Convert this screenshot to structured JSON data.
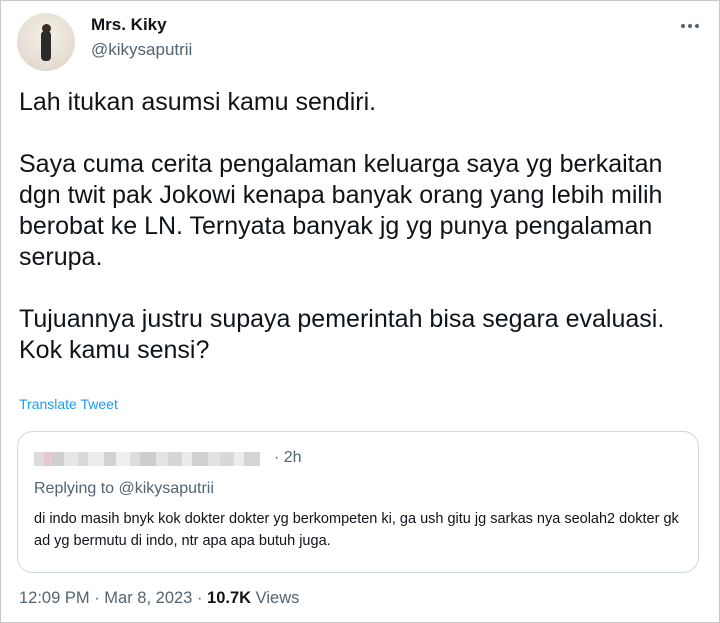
{
  "author": {
    "display_name": "Mrs. Kiky",
    "handle": "@kikysaputrii"
  },
  "tweet": {
    "text": "Lah itukan asumsi kamu sendiri.\n\nSaya cuma cerita pengalaman keluarga saya yg berkaitan dgn twit pak Jokowi kenapa banyak orang yang lebih milih berobat ke LN. Ternyata banyak jg yg punya pengalaman serupa.\n\nTujuannya justru supaya pemerintah bisa segara evaluasi. Kok kamu sensi?",
    "translate_label": "Translate Tweet"
  },
  "quoted_tweet": {
    "time": "· 2h",
    "replying_prefix": "Replying to ",
    "replying_handle": "@kikysaputrii",
    "text": "di indo masih bnyk kok dokter dokter yg berkompeten ki, ga ush gitu jg sarkas nya seolah2 dokter gk ad yg bermutu di indo, ntr apa apa butuh juga."
  },
  "meta": {
    "time": "12:09 PM",
    "separator1": " · ",
    "date": "Mar 8, 2023",
    "separator2": " · ",
    "views_count": "10.7K",
    "views_label": " Views"
  },
  "icons": {
    "more": "more-horizontal-icon",
    "avatar": "profile-photo"
  },
  "colors": {
    "link": "#1d9bf0",
    "secondary_text": "#536471",
    "primary_text": "#0f1419",
    "card_border": "#cfd9de"
  }
}
